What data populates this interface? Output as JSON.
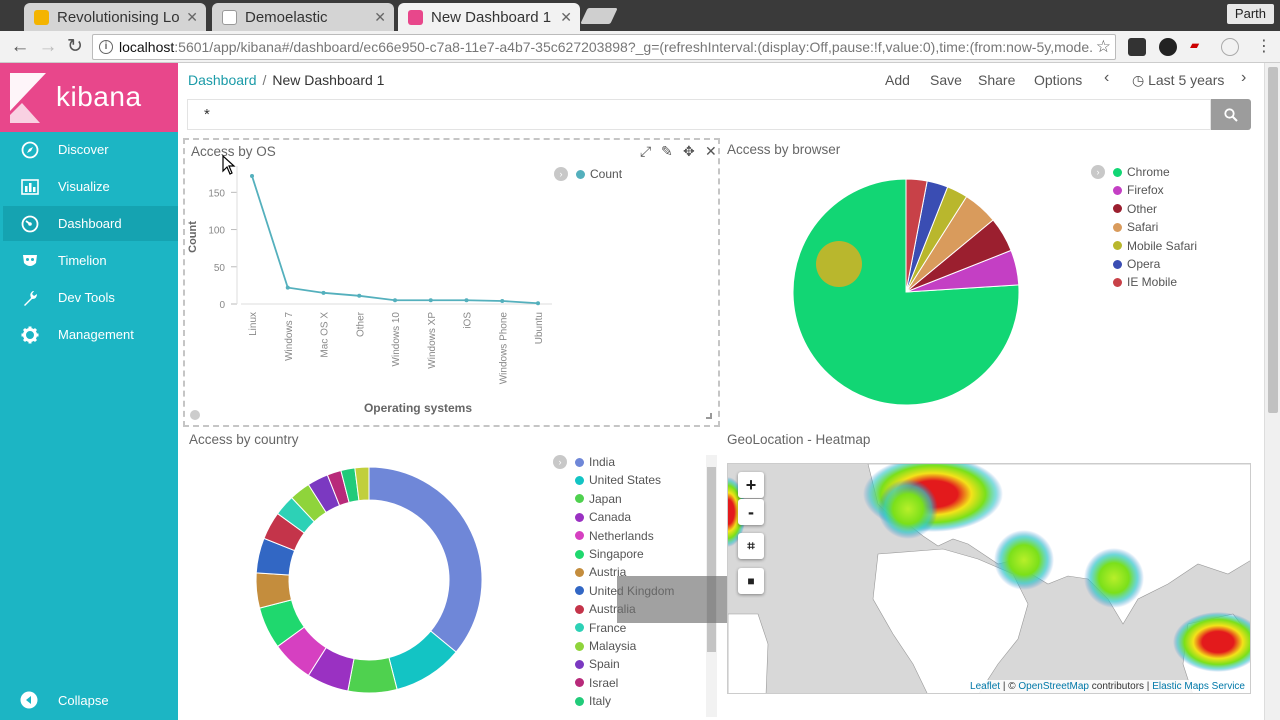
{
  "browser": {
    "tabs": [
      {
        "title": "Revolutionising Lo",
        "favicon_color": "#f4b400",
        "active": false
      },
      {
        "title": "Demoelastic",
        "favicon_color": "#ffffff",
        "active": false
      },
      {
        "title": "New Dashboard 1 -",
        "favicon_color": "#e8478b",
        "active": true
      }
    ],
    "profile_name": "Parth",
    "url_host": "localhost",
    "url_path": ":5601/app/kibana#/dashboard/ec66e950-c7a8-11e7-a4b7-35c627203898?_g=(refreshInterval:(display:Off,pause:!f,value:0),time:(from:now-5y,mode..."
  },
  "sidebar": {
    "brand": "kibana",
    "items": [
      {
        "label": "Discover",
        "icon": "compass-icon"
      },
      {
        "label": "Visualize",
        "icon": "bar-chart-icon"
      },
      {
        "label": "Dashboard",
        "icon": "dashboard-gauge-icon"
      },
      {
        "label": "Timelion",
        "icon": "timelion-mask-icon"
      },
      {
        "label": "Dev Tools",
        "icon": "wrench-icon"
      },
      {
        "label": "Management",
        "icon": "gear-icon"
      }
    ],
    "active": "Dashboard",
    "collapse_label": "Collapse"
  },
  "topnav": {
    "breadcrumb_root": "Dashboard",
    "breadcrumb_current": "New Dashboard 1",
    "menu": {
      "add": "Add",
      "save": "Save",
      "share": "Share",
      "options": "Options"
    },
    "time_range": "Last 5 years"
  },
  "query": {
    "value": "*"
  },
  "panels": {
    "os": {
      "title": "Access by OS"
    },
    "browser": {
      "title": "Access by browser"
    },
    "country": {
      "title": "Access by country"
    },
    "geo": {
      "title": "GeoLocation - Heatmap"
    }
  },
  "map": {
    "zoom_in": "+",
    "zoom_out": "-",
    "attribution": {
      "leaflet": "Leaflet",
      "sep1": " | © ",
      "osm": "OpenStreetMap",
      "contrib": " contributors | ",
      "ems": "Elastic Maps Service"
    }
  },
  "chart_data": [
    {
      "type": "line",
      "title": "Access by OS",
      "xlabel": "Operating systems",
      "ylabel": "Count",
      "categories": [
        "Linux",
        "Windows 7",
        "Mac OS X",
        "Other",
        "Windows 10",
        "Windows XP",
        "iOS",
        "Windows Phone",
        "Ubuntu"
      ],
      "series": [
        {
          "name": "Count",
          "values": [
            172,
            22,
            15,
            11,
            5,
            5,
            5,
            4,
            1
          ],
          "color": "#54b0bd"
        }
      ],
      "yticks": [
        0,
        50,
        100,
        150
      ],
      "ylim": [
        0,
        180
      ],
      "legend": "top-right"
    },
    {
      "type": "pie",
      "title": "Access by browser",
      "slices": [
        {
          "label": "Chrome",
          "value": 76,
          "color": "#12d674"
        },
        {
          "label": "Firefox",
          "value": 5,
          "color": "#c43fc4"
        },
        {
          "label": "Other",
          "value": 5,
          "color": "#9b1f2f"
        },
        {
          "label": "Safari",
          "value": 5,
          "color": "#d99b5c"
        },
        {
          "label": "Mobile Safari",
          "value": 3,
          "color": "#b9b72d"
        },
        {
          "label": "Opera",
          "value": 3,
          "color": "#3a4db3"
        },
        {
          "label": "IE Mobile",
          "value": 3,
          "color": "#c84148"
        }
      ],
      "legend": "top-right"
    },
    {
      "type": "pie",
      "subtype": "donut",
      "title": "Access by country",
      "slices": [
        {
          "label": "India",
          "value": 36,
          "color": "#6f87d8"
        },
        {
          "label": "United States",
          "value": 10,
          "color": "#13c4c4"
        },
        {
          "label": "Japan",
          "value": 7,
          "color": "#4fd14f"
        },
        {
          "label": "Canada",
          "value": 6,
          "color": "#9a31c2"
        },
        {
          "label": "Netherlands",
          "value": 6,
          "color": "#d640c1"
        },
        {
          "label": "Singapore",
          "value": 6,
          "color": "#1fd86e"
        },
        {
          "label": "Austria",
          "value": 5,
          "color": "#c48d3d"
        },
        {
          "label": "United Kingdom",
          "value": 5,
          "color": "#3267c4"
        },
        {
          "label": "Australia",
          "value": 4,
          "color": "#c4344a"
        },
        {
          "label": "France",
          "value": 3,
          "color": "#2dd1b6"
        },
        {
          "label": "Malaysia",
          "value": 3,
          "color": "#8fd43b"
        },
        {
          "label": "Spain",
          "value": 3,
          "color": "#7b39c1"
        },
        {
          "label": "Israel",
          "value": 2,
          "color": "#b82a7a"
        },
        {
          "label": "Italy",
          "value": 2,
          "color": "#21cb7a"
        },
        {
          "label": "",
          "value": 2,
          "color": "#c1cf3c"
        }
      ],
      "legend": "right"
    }
  ]
}
